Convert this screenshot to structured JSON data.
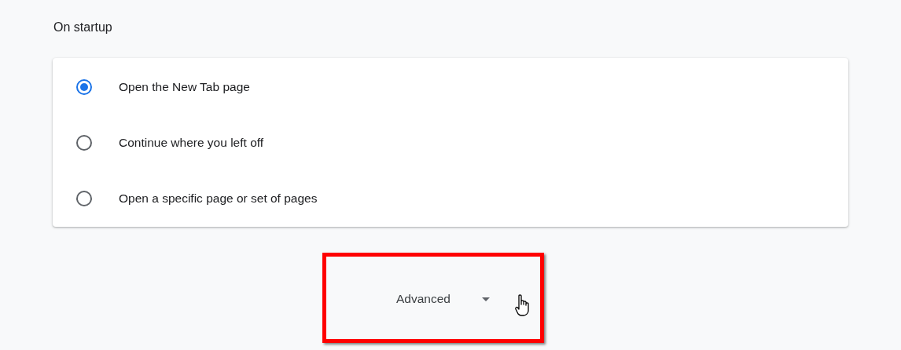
{
  "section": {
    "title": "On startup"
  },
  "options": [
    {
      "label": "Open the New Tab page",
      "selected": true
    },
    {
      "label": "Continue where you left off",
      "selected": false
    },
    {
      "label": "Open a specific page or set of pages",
      "selected": false
    }
  ],
  "advanced": {
    "label": "Advanced",
    "highlighted": true
  }
}
